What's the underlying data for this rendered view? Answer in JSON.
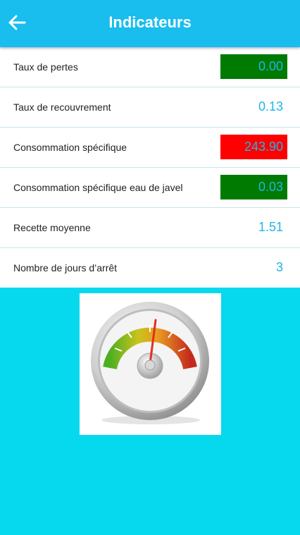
{
  "header": {
    "title": "Indicateurs",
    "back_icon": "arrow-left-icon"
  },
  "indicators": [
    {
      "label": "Taux de pertes",
      "value": "0.00",
      "status": "green",
      "status_color": "#007a00"
    },
    {
      "label": "Taux de recouvrement",
      "value": "0.13",
      "status": "none"
    },
    {
      "label": "Consommation spécifique",
      "value": "243.90",
      "status": "red",
      "status_color": "#ff0000"
    },
    {
      "label": "Consommation spécifique eau de javel",
      "value": "0.03",
      "status": "green",
      "status_color": "#007a00"
    },
    {
      "label": "Recette moyenne",
      "value": "1.51",
      "status": "none"
    },
    {
      "label": "Nombre de jours d’arrêt",
      "value": "3",
      "status": "none"
    }
  ],
  "gauge": {
    "icon": "speedometer-gauge-icon"
  },
  "colors": {
    "header": "#19bdee",
    "background": "#06d9ee",
    "value_text": "#21b5e7"
  }
}
